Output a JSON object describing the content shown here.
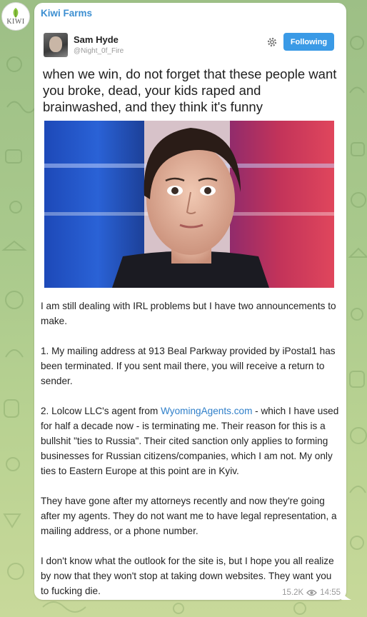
{
  "channel": {
    "name": "Kiwi Farms",
    "avatar_icon": "kiwi-farms-logo",
    "avatar_text": "KIWI"
  },
  "tweet": {
    "author_name": "Sam Hyde",
    "author_handle": "@Night_0f_Fire",
    "follow_label": "Following",
    "text": "when we win, do not forget that these people want you broke, dead, your kids raped and brainwashed, and they think it's funny",
    "colors": {
      "follow_button": "#3a9ae6"
    }
  },
  "message": {
    "paragraphs": [
      {
        "text": "I am still dealing with IRL problems but I have two announcements to make."
      },
      {
        "text": "1. My mailing address at 913 Beal Parkway provided by iPostal1 has been terminated. If you sent mail there, you will receive a return to sender."
      },
      {
        "before": "2. Lolcow LLC's agent from ",
        "link": "WyomingAgents.com",
        "after": " - which I have used for half a decade now - is terminating me. Their reason for this is a bullshit \"ties to Russia\". Their cited sanction only applies to forming businesses for Russian citizens/companies, which I am not. My only ties to Eastern Europe at this point are in Kyiv."
      },
      {
        "text": "They have gone after my attorneys recently and now they're going after my agents. They do not want me to have legal representation, a mailing address, or a phone number."
      },
      {
        "text": "I don't know what the outlook for the site is, but I hope you all realize by now that they won't stop at taking down websites. They want you to fucking die."
      }
    ],
    "views": "15.2K",
    "time": "14:55"
  },
  "colors": {
    "channel_name": "#3d8fd1",
    "link": "#2f7fc9",
    "background": "#a9c98c"
  }
}
